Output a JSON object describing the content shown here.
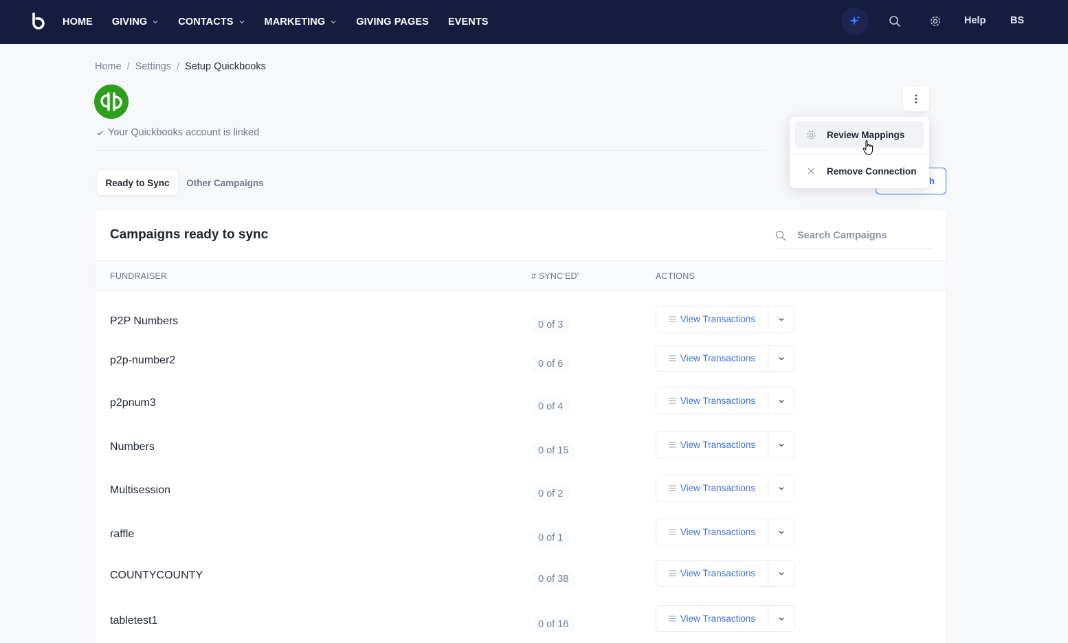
{
  "colors": {
    "nav_bg": "#161c3d",
    "accent": "#3d6fd9",
    "qb_green": "#2ca01c",
    "ai_star": "#3f7bff"
  },
  "nav": {
    "items": [
      {
        "label": "HOME",
        "dropdown": false
      },
      {
        "label": "GIVING",
        "dropdown": true
      },
      {
        "label": "CONTACTS",
        "dropdown": true
      },
      {
        "label": "MARKETING",
        "dropdown": true
      },
      {
        "label": "GIVING PAGES",
        "dropdown": false
      },
      {
        "label": "EVENTS",
        "dropdown": false
      }
    ],
    "help_label": "Help",
    "user_initials": "BS",
    "icons": [
      "ai-sparkle-icon",
      "search-icon",
      "gear-icon"
    ]
  },
  "breadcrumb": [
    "Home",
    "Settings",
    "Setup Quickbooks"
  ],
  "account": {
    "status_text": "Your Quickbooks account is linked"
  },
  "menu": {
    "items": [
      {
        "label": "Review Mappings",
        "icon": "gear-icon"
      },
      {
        "label": "Remove Connection",
        "icon": "close-icon"
      }
    ],
    "partially_hidden_button_text": "h"
  },
  "tabs": [
    {
      "label": "Ready to Sync",
      "active": true
    },
    {
      "label": "Other Campaigns",
      "active": false
    }
  ],
  "card": {
    "title": "Campaigns ready to sync",
    "search_placeholder": "Search Campaigns",
    "columns": [
      "FUNDRAISER",
      "# SYNC'ED'",
      "ACTIONS"
    ],
    "rows": [
      {
        "name": "P2P Numbers",
        "synced": "0 of 3"
      },
      {
        "name": "p2p-number2",
        "synced": "0 of 6"
      },
      {
        "name": "p2pnum3",
        "synced": "0 of 4"
      },
      {
        "name": "Numbers",
        "synced": "0 of 15"
      },
      {
        "name": "Multisession",
        "synced": "0 of 2"
      },
      {
        "name": "raffle",
        "synced": "0 of 1"
      },
      {
        "name": "COUNTYCOUNTY",
        "synced": "0 of 38"
      },
      {
        "name": "tabletest1",
        "synced": "0 of 16"
      }
    ],
    "action_label": "View Transactions"
  }
}
